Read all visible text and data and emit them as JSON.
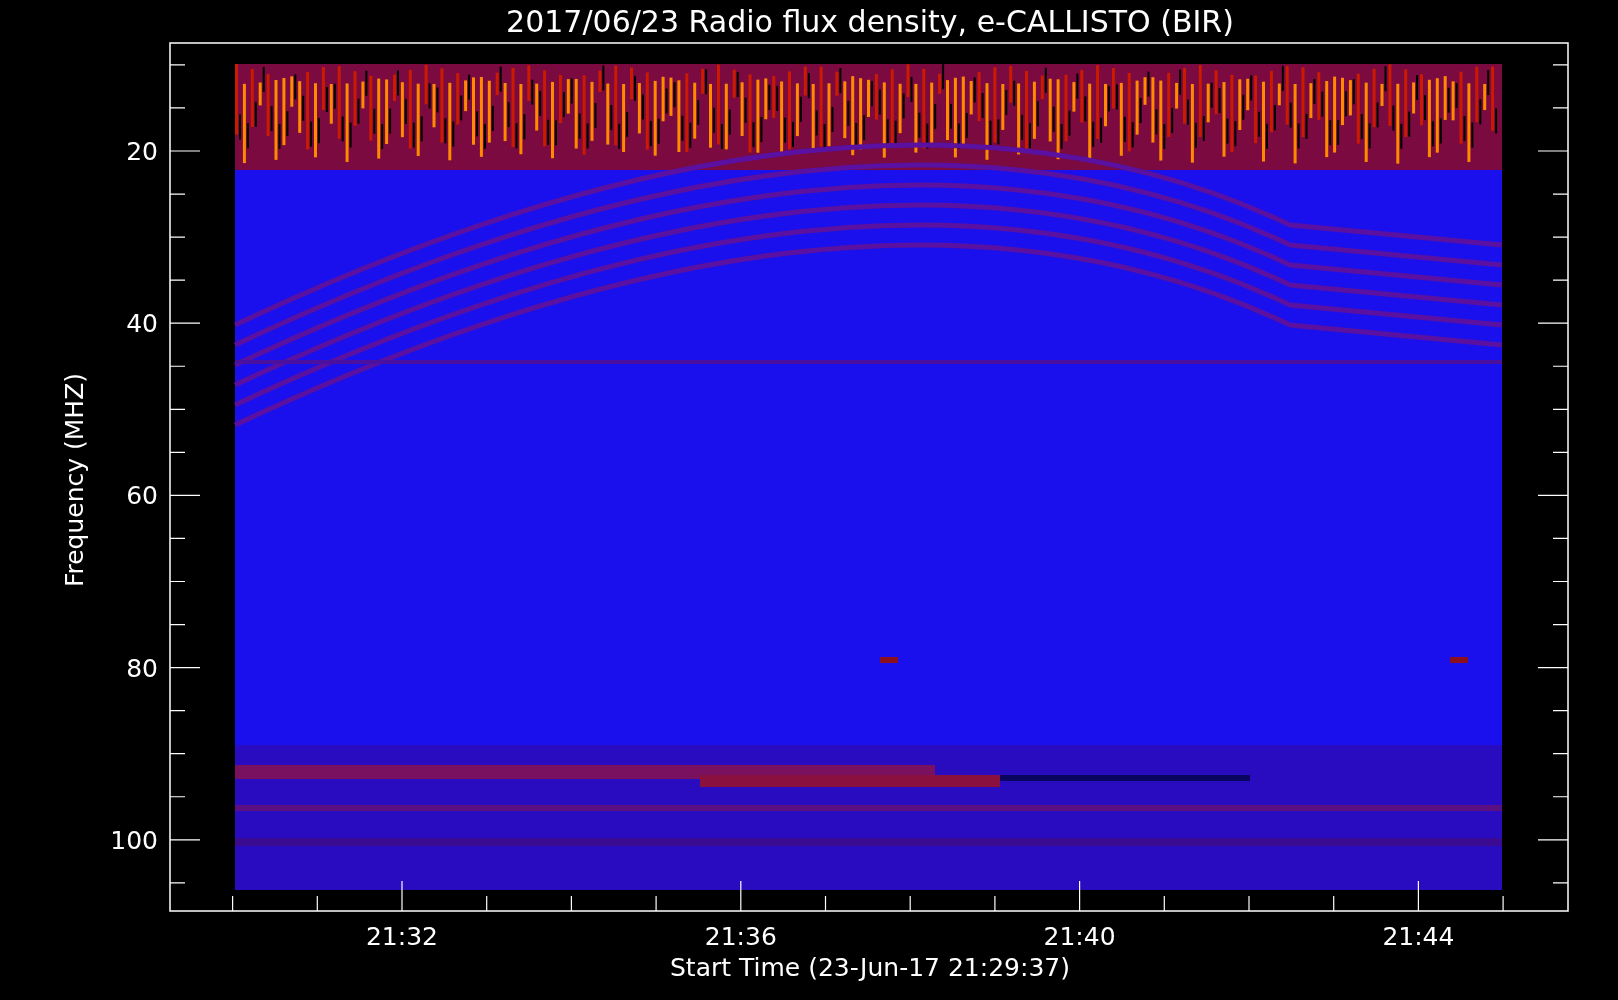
{
  "plot": {
    "title": "2017/06/23  Radio flux density, e-CALLISTO (BIR)",
    "ylabel": "Frequency (MHZ)",
    "xlabel": "Start Time (23-Jun-17 21:29:37)",
    "y_tick_labels": [
      "20",
      "40",
      "60",
      "80",
      "100"
    ],
    "x_tick_labels": [
      "21:32",
      "21:36",
      "21:40",
      "21:44"
    ]
  }
}
